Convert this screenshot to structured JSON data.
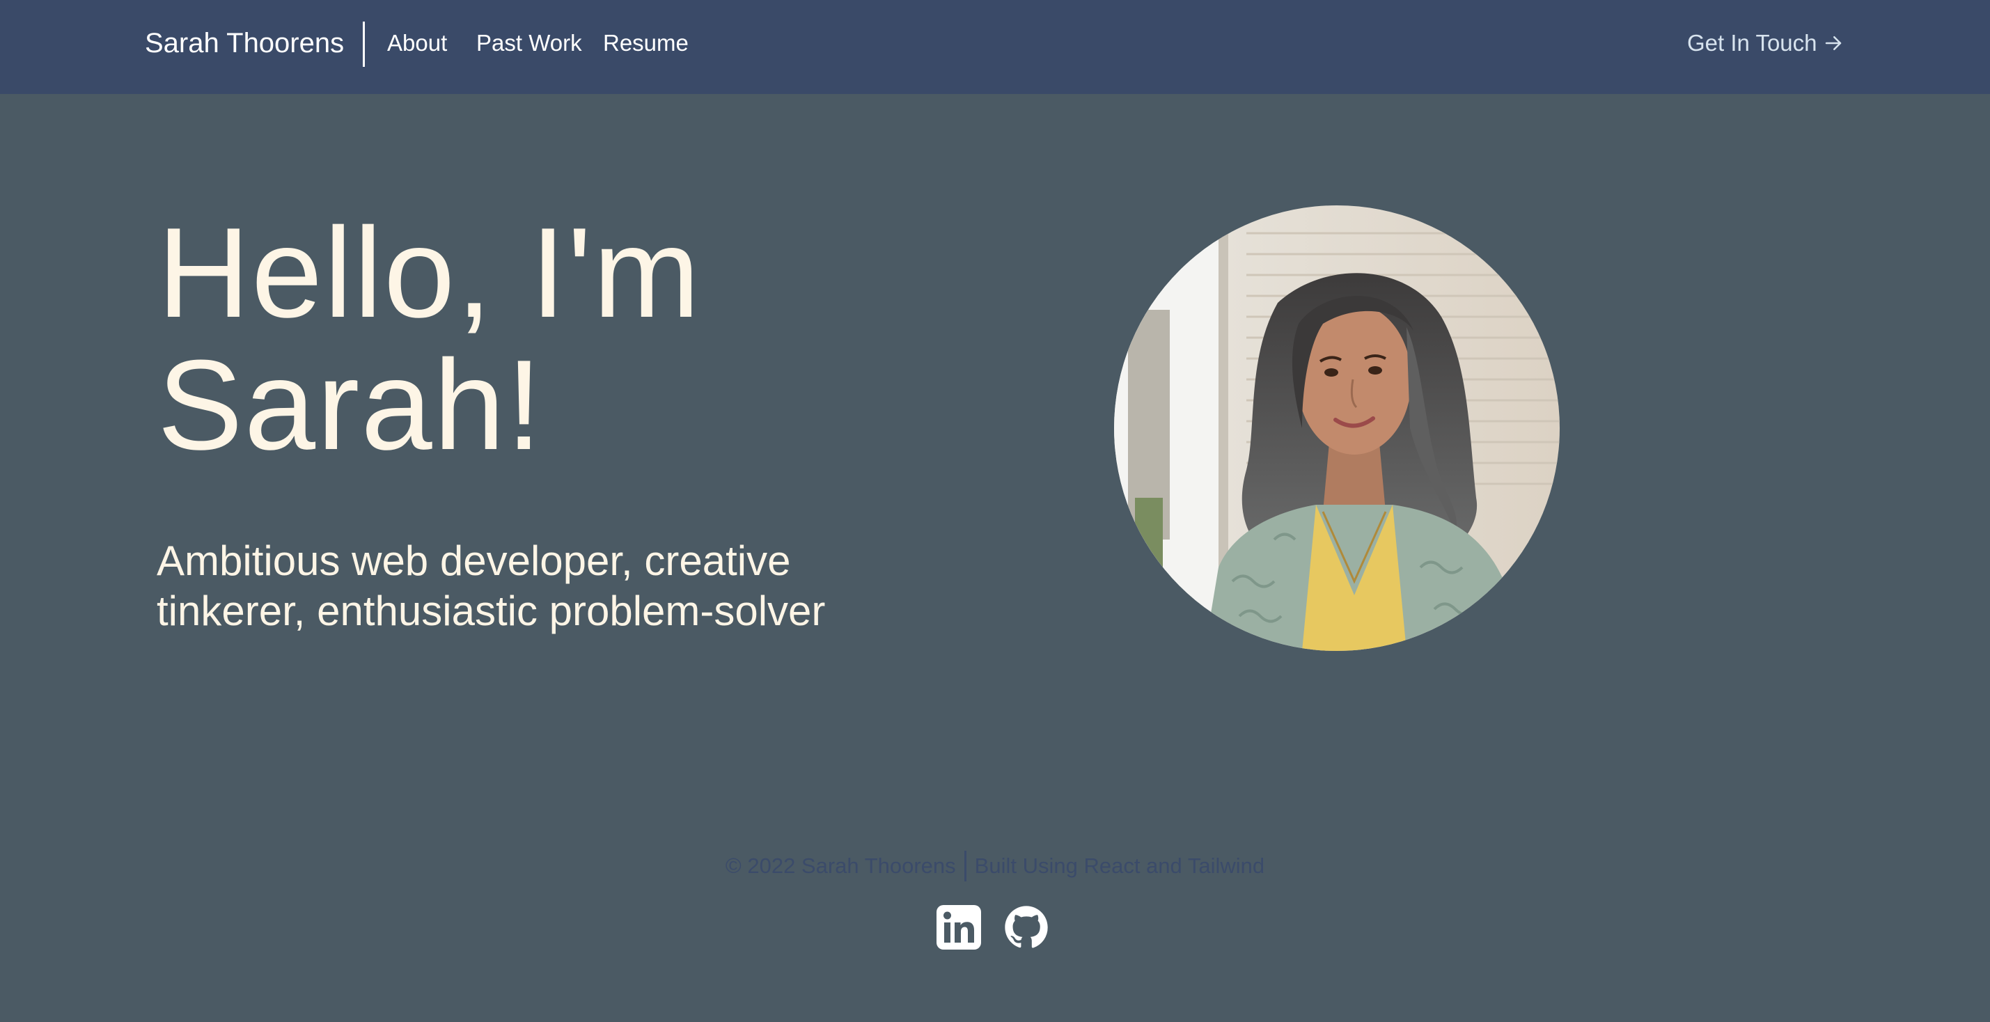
{
  "header": {
    "brand": "Sarah Thoorens",
    "nav": [
      "About",
      "Past Work",
      "Resume"
    ],
    "cta_label": "Get In Touch",
    "cta_icon": "arrow-right-icon"
  },
  "hero": {
    "title_line1": "Hello, I'm",
    "title_line2": "Sarah!",
    "subtitle_line1": "Ambitious web developer, creative",
    "subtitle_line2": "tinkerer, enthusiastic problem-solver",
    "portrait_icon": "profile-photo"
  },
  "footer": {
    "copyright": "© 2022 Sarah Thoorens",
    "built_with": "Built Using React and Tailwind",
    "social_icons": [
      "linkedin-icon",
      "github-icon"
    ]
  },
  "colors": {
    "header_bg": "#3a4a68",
    "page_bg": "#4b5a64",
    "hero_text": "#fdf5e6",
    "footer_text": "#3b4b6a",
    "cta_text": "#d7e3ee"
  }
}
